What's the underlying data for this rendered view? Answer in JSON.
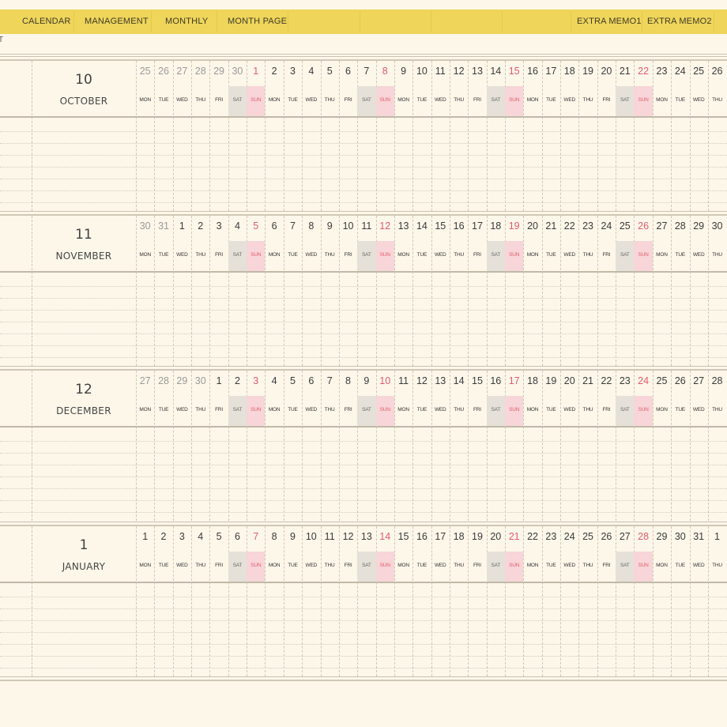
{
  "nav": {
    "tabs": [
      {
        "label": "CALENDAR"
      },
      {
        "label": "MANAGEMENT"
      },
      {
        "label": "MONTHLY"
      },
      {
        "label": "MONTH PAGE"
      },
      {
        "label": "EXTRA MEMO1"
      },
      {
        "label": "EXTRA MEMO2"
      }
    ]
  },
  "page_marker": "T",
  "weekday_labels": [
    "MON",
    "TUE",
    "WED",
    "THU",
    "FRI",
    "SAT",
    "SUN"
  ],
  "colors": {
    "nav_bar": "#efd55a",
    "background": "#fdf7ea",
    "saturday_shade": "#e5e1d8",
    "sunday_shade": "#f7d5d8",
    "sunday_text": "#e35a6b",
    "outside_month_text": "#9a9a9a"
  },
  "months": [
    {
      "number": "10",
      "name": "OCTOBER",
      "days": [
        "25",
        "26",
        "27",
        "28",
        "29",
        "30",
        "1",
        "2",
        "3",
        "4",
        "5",
        "6",
        "7",
        "8",
        "9",
        "10",
        "11",
        "12",
        "13",
        "14",
        "15",
        "16",
        "17",
        "18",
        "19",
        "20",
        "21",
        "22",
        "23",
        "24",
        "25",
        "26"
      ],
      "outside_count": 6
    },
    {
      "number": "11",
      "name": "NOVEMBER",
      "days": [
        "30",
        "31",
        "1",
        "2",
        "3",
        "4",
        "5",
        "6",
        "7",
        "8",
        "9",
        "10",
        "11",
        "12",
        "13",
        "14",
        "15",
        "16",
        "17",
        "18",
        "19",
        "20",
        "21",
        "22",
        "23",
        "24",
        "25",
        "26",
        "27",
        "28",
        "29",
        "30"
      ],
      "outside_count": 2
    },
    {
      "number": "12",
      "name": "DECEMBER",
      "days": [
        "27",
        "28",
        "29",
        "30",
        "1",
        "2",
        "3",
        "4",
        "5",
        "6",
        "7",
        "8",
        "9",
        "10",
        "11",
        "12",
        "13",
        "14",
        "15",
        "16",
        "17",
        "18",
        "19",
        "20",
        "21",
        "22",
        "23",
        "24",
        "25",
        "26",
        "27",
        "28"
      ],
      "outside_count": 4
    },
    {
      "number": "1",
      "name": "JANUARY",
      "days": [
        "1",
        "2",
        "3",
        "4",
        "5",
        "6",
        "7",
        "8",
        "9",
        "10",
        "11",
        "12",
        "13",
        "14",
        "15",
        "16",
        "17",
        "18",
        "19",
        "20",
        "21",
        "22",
        "23",
        "24",
        "25",
        "26",
        "27",
        "28",
        "29",
        "30",
        "31",
        "1"
      ],
      "outside_count": 0
    }
  ]
}
